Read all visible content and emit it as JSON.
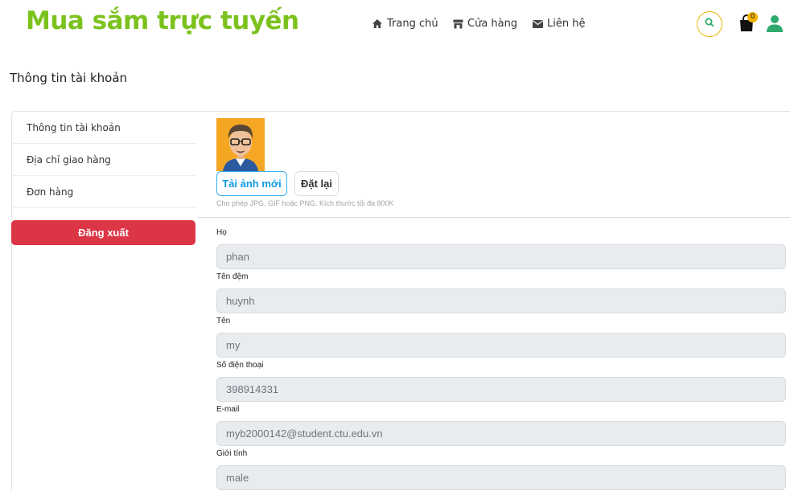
{
  "header": {
    "brand": "Mua sắm trực tuyến",
    "nav": [
      {
        "label": "Trang chủ",
        "icon": "home-icon"
      },
      {
        "label": "Cửa hàng",
        "icon": "store-icon"
      },
      {
        "label": "Liên hệ",
        "icon": "envelope-icon"
      }
    ],
    "cart_count": "0",
    "colors": {
      "brand": "#7cc21e",
      "accent": "#f2b400",
      "user": "#2eaa6c"
    }
  },
  "page_title": "Thông tin tài khoản",
  "sidebar": {
    "items": [
      {
        "label": "Thông tin tài khoản"
      },
      {
        "label": "Địa chỉ giao hàng"
      },
      {
        "label": "Đơn hàng"
      }
    ],
    "logout_label": "Đăng xuất",
    "logout_color": "#dc3545"
  },
  "profile": {
    "upload_label": "Tải ảnh mới",
    "reset_label": "Đặt lại",
    "hint": "Cho phép JPG, GIF hoặc PNG. Kích thước tối đa 800K"
  },
  "fields": [
    {
      "label": "Họ",
      "value": "phan"
    },
    {
      "label": "Tên đệm",
      "value": "huynh"
    },
    {
      "label": "Tên",
      "value": "my"
    },
    {
      "label": "Số điện thoại",
      "value": "398914331"
    },
    {
      "label": "E-mail",
      "value": "myb2000142@student.ctu.edu.vn"
    },
    {
      "label": "Giới tính",
      "value": "male"
    }
  ]
}
